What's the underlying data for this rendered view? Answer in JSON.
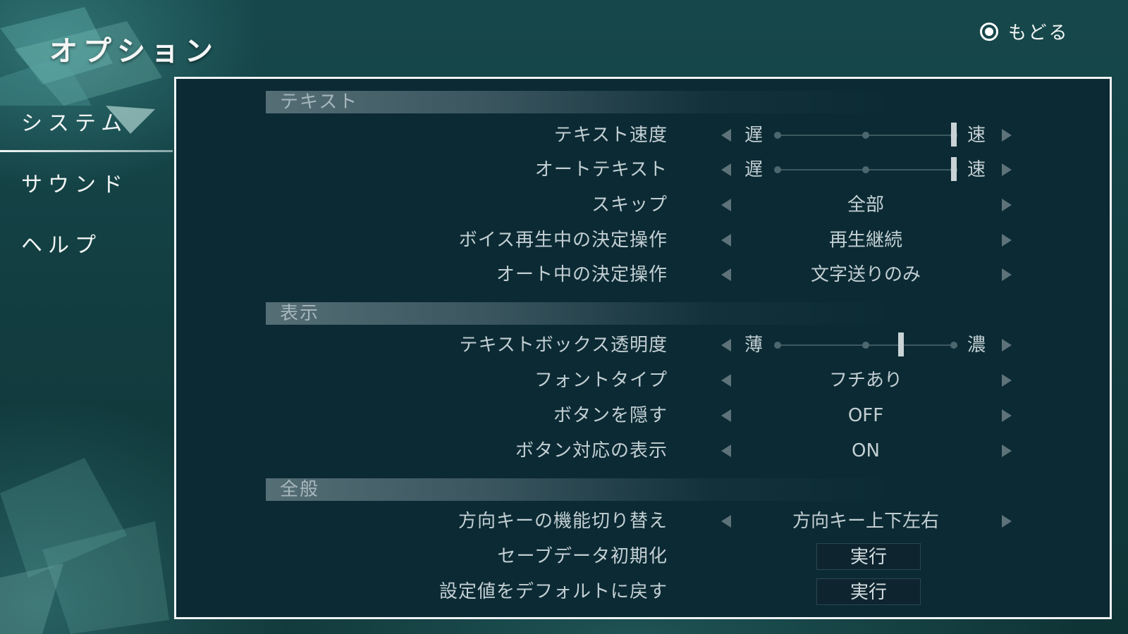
{
  "header": {
    "title": "オプション",
    "back_label": "もどる"
  },
  "nav": {
    "items": [
      {
        "label": "システム",
        "active": true
      },
      {
        "label": "サウンド"
      },
      {
        "label": "ヘルプ"
      }
    ]
  },
  "sections": {
    "text": {
      "title": "テキスト",
      "text_speed": {
        "label": "テキスト速度",
        "min_label": "遅",
        "max_label": "速",
        "level": 1.0
      },
      "auto_text": {
        "label": "オートテキスト",
        "min_label": "遅",
        "max_label": "速",
        "level": 1.0
      },
      "skip": {
        "label": "スキップ",
        "value": "全部"
      },
      "voice_confirm": {
        "label": "ボイス再生中の決定操作",
        "value": "再生継続"
      },
      "auto_confirm": {
        "label": "オート中の決定操作",
        "value": "文字送りのみ"
      }
    },
    "display": {
      "title": "表示",
      "textbox_opacity": {
        "label": "テキストボックス透明度",
        "min_label": "薄",
        "max_label": "濃",
        "level": 0.7
      },
      "font_type": {
        "label": "フォントタイプ",
        "value": "フチあり"
      },
      "hide_buttons": {
        "label": "ボタンを隠す",
        "value": "OFF"
      },
      "button_hints": {
        "label": "ボタン対応の表示",
        "value": "ON"
      }
    },
    "general": {
      "title": "全般",
      "direction_keys": {
        "label": "方向キーの機能切り替え",
        "value": "方向キー上下左右"
      },
      "init_save": {
        "label": "セーブデータ初期化",
        "button": "実行"
      },
      "reset_defaults": {
        "label": "設定値をデフォルトに戻す",
        "button": "実行"
      }
    }
  }
}
